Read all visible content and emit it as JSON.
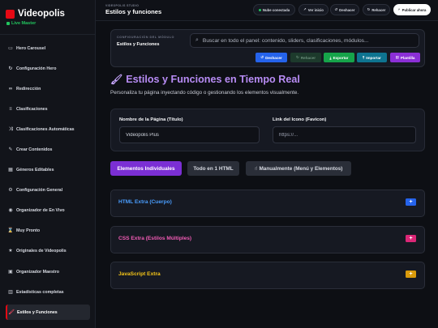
{
  "brand": {
    "name": "Videopolis",
    "sub": "Live Master"
  },
  "colors": {
    "accent": "#e50914",
    "brand_sub": "#22c55e",
    "purple": "#7b2fd4",
    "title_purple": "#b88cf5",
    "html_blue": "#4a9eff",
    "css_pink": "#f15bb5",
    "js_yellow": "#f5c518"
  },
  "sidebar": {
    "items": [
      {
        "label": "Hero Carousel",
        "icon": "carousel-icon"
      },
      {
        "label": "Configuración Hero",
        "icon": "refresh-icon"
      },
      {
        "label": "Redirección",
        "icon": "link-icon"
      },
      {
        "label": "Clasificaciones",
        "icon": "sliders-icon"
      },
      {
        "label": "Clasificaciones Automáticas",
        "icon": "shuffle-icon"
      },
      {
        "label": "Crear Contenidos",
        "icon": "pencil-icon"
      },
      {
        "label": "Géneros Editables",
        "icon": "grid-icon"
      },
      {
        "label": "Configuración General",
        "icon": "gear-icon"
      },
      {
        "label": "Organizador de En Vivo",
        "icon": "broadcast-icon"
      },
      {
        "label": "Muy Pronto",
        "icon": "hourglass-icon"
      },
      {
        "label": "Originales de Videopolis",
        "icon": "star-icon"
      },
      {
        "label": "Organizador Maestro",
        "icon": "film-icon"
      },
      {
        "label": "Estadísticas completas",
        "icon": "chart-icon"
      },
      {
        "label": "Estilos y Funciones",
        "icon": "brush-icon"
      }
    ],
    "active_index": 13
  },
  "topbar": {
    "studio": "VIDEOPOLIS STUDIO",
    "title": "Estilos y funciones",
    "cloud_status": "Nube conectada",
    "view_start": "Ver inicio",
    "undo": "Deshacer",
    "redo": "Rehacer",
    "publish": "Publicar ahora"
  },
  "module": {
    "label": "CONFIGURACIÓN DEL MÓDULO",
    "name": "Estilos y Funciones",
    "search_placeholder": "Buscar en todo el panel: contenido, sliders, clasificaciones, módulos...",
    "actions": {
      "undo": "Deshacer",
      "redo": "Rehacer",
      "export": "Exportar",
      "import": "Importar",
      "template": "Plantilla"
    }
  },
  "page": {
    "title": "Estilos y Funciones en Tiempo Real",
    "description": "Personaliza tu página inyectando código o gestionando los elementos visualmente."
  },
  "form": {
    "page_name_label": "Nombre de la Página (Título)",
    "page_name_value": "Videopolis Plus",
    "favicon_label": "Link del Icono (Favicon)",
    "favicon_placeholder": "https://..."
  },
  "tabs": [
    {
      "label": "Elementos Individuales"
    },
    {
      "label": "Todo en 1 HTML"
    },
    {
      "label": "Manualmente (Menú y Elementos)"
    }
  ],
  "sections": [
    {
      "title": "HTML Extra (Cuerpo)",
      "add": "+"
    },
    {
      "title": "CSS Extra (Estilos Múltiples)",
      "add": "+"
    },
    {
      "title": "JavaScript Extra",
      "add": "+"
    }
  ]
}
